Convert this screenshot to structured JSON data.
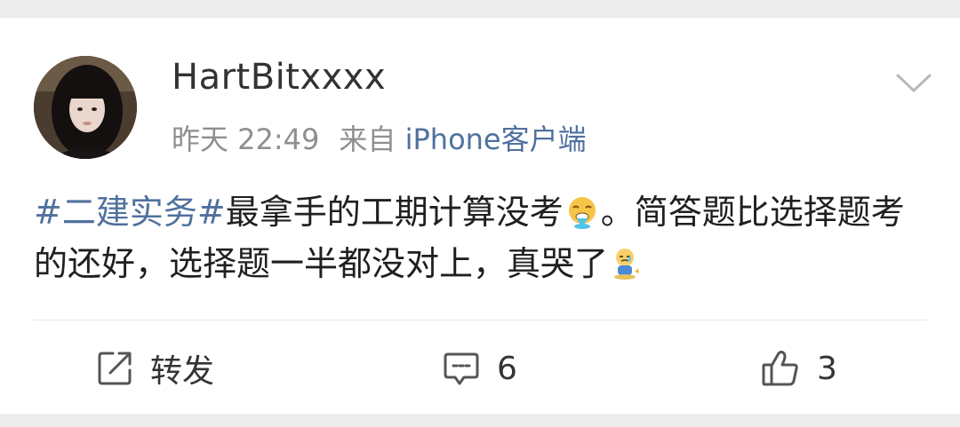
{
  "post": {
    "username": "HartBitxxxx",
    "time": "昨天 22:49",
    "source_prefix": "来自",
    "source_app": "iPhone客户端",
    "hashtag": "#二建实务#",
    "text_part1": "最拿手的工期计算没考",
    "text_part2": "。简答题比选择题考的还好，选择题一半都没对上，真哭了",
    "emoji_1": "vomit-face-emoji",
    "emoji_2": "crying-sitting-emoji"
  },
  "actions": {
    "repost_label": "转发",
    "comment_count": "6",
    "like_count": "3"
  },
  "icons": {
    "more": "chevron-down-icon",
    "repost": "repost-icon",
    "comment": "comment-icon",
    "like": "thumbs-up-icon"
  },
  "colors": {
    "link": "#50719e",
    "meta": "#8f8f8f",
    "text": "#1f1f1f",
    "background": "#ececec",
    "card": "#ffffff"
  }
}
